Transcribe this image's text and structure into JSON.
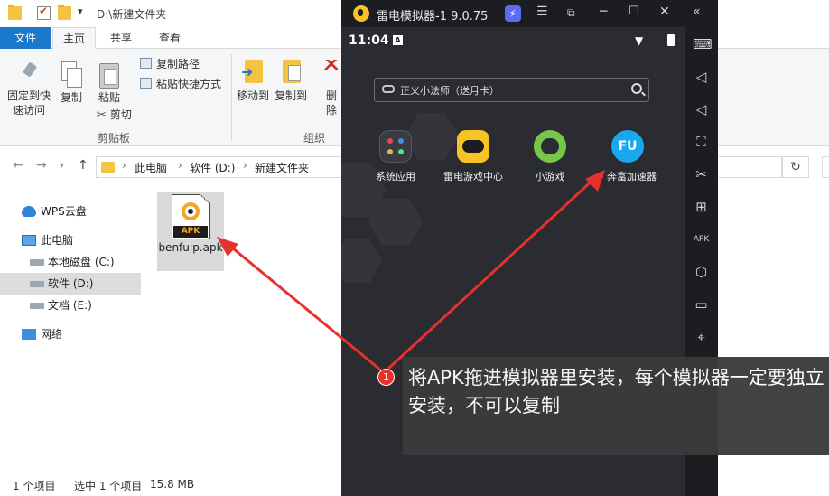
{
  "explorer": {
    "title_path": "D:\\新建文件夹",
    "qa_dropdown": "▾",
    "tabs": {
      "file": "文件",
      "home": "主页",
      "share": "共享",
      "view": "查看"
    },
    "ribbon": {
      "pin": "固定到快\n速访问",
      "copy": "复制",
      "paste": "粘贴",
      "copy_path": "复制路径",
      "paste_shortcut": "粘贴快捷方式",
      "cut": "剪切",
      "clipboard_group": "剪贴板",
      "move_to": "移动到",
      "copy_to": "复制到",
      "delete": "删除",
      "organize_group": "组织"
    },
    "address": {
      "crumbs": [
        "此电脑",
        "软件 (D:)",
        "新建文件夹"
      ],
      "separator": "›"
    },
    "nav": {
      "wps": "WPS云盘",
      "this_pc": "此电脑",
      "drive_c": "本地磁盘 (C:)",
      "drive_d": "软件 (D:)",
      "drive_e": "文档 (E:)",
      "network": "网络"
    },
    "file": {
      "name": "benfuip.apk",
      "badge": "APK"
    },
    "status": {
      "count": "1 个项目",
      "selected": "选中 1 个项目",
      "size": "15.8 MB"
    }
  },
  "emulator": {
    "title": "雷电模拟器-1 9.0.75",
    "time": "11:04",
    "status_badge": "A",
    "search_placeholder": "正义小法师（送月卡）",
    "apps": [
      {
        "label": "系统应用",
        "icon": "system-apps-icon"
      },
      {
        "label": "雷电游戏中心",
        "icon": "game-center-icon"
      },
      {
        "label": "小游戏",
        "icon": "mini-games-icon"
      },
      {
        "label": "奔富加速器",
        "icon": "benfu-accelerator-icon",
        "fu_text": "FU"
      }
    ]
  },
  "annotation": {
    "number": "1",
    "text": "将APK拖进模拟器里安装，每个模拟器一定要独立安装，不可以复制",
    "arrow_color": "#e8312c"
  }
}
